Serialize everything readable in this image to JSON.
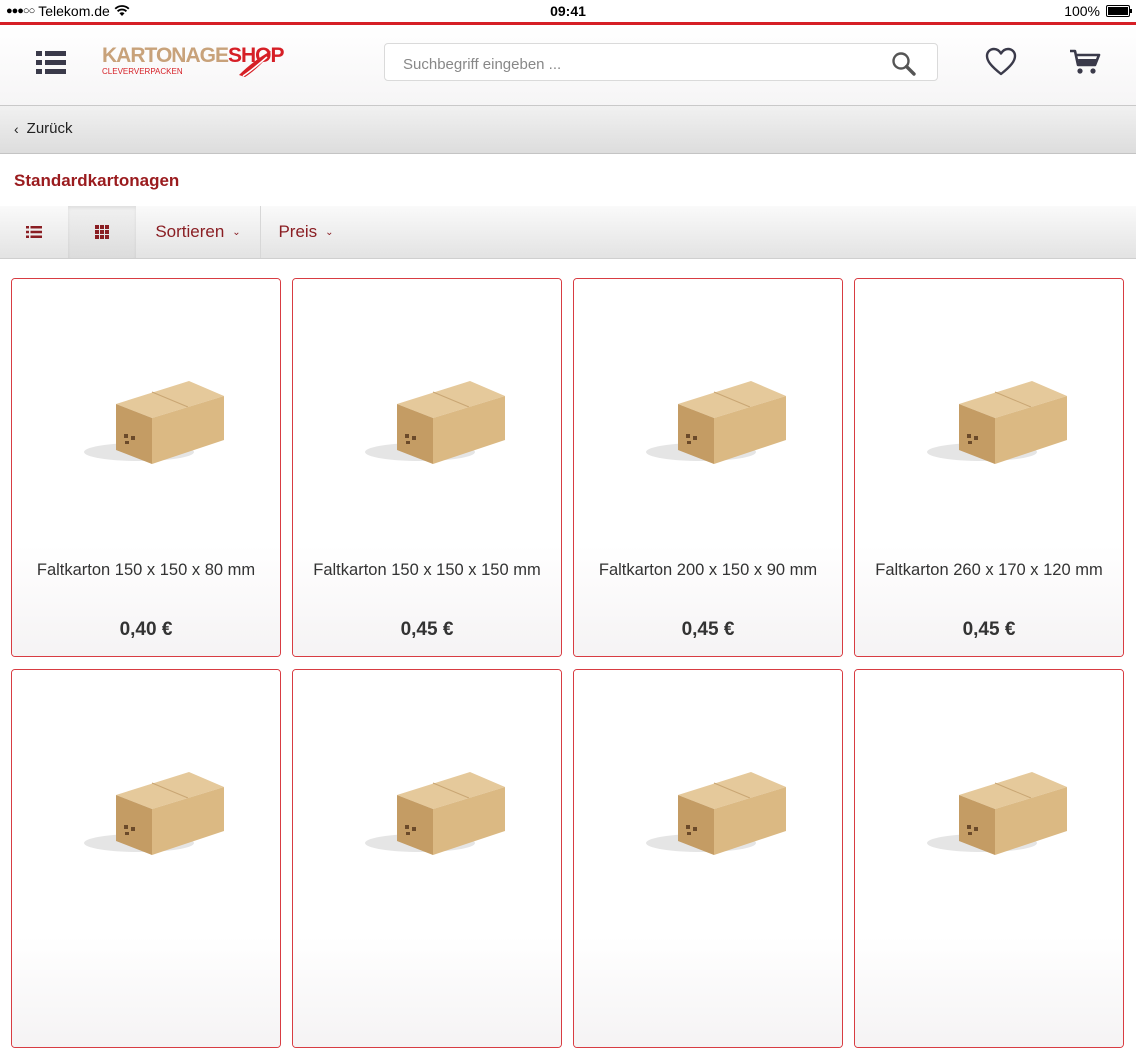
{
  "status_bar": {
    "carrier": "Telekom.de",
    "time": "09:41",
    "battery": "100%"
  },
  "header": {
    "logo": {
      "word1": "KARTONAGE",
      "word2": "SHOP",
      "tagline": "CLEVERVERPACKEN"
    },
    "search": {
      "placeholder": "Suchbegriff eingeben ..."
    }
  },
  "nav": {
    "back_label": "Zurück"
  },
  "category": {
    "title": "Standardkartonagen"
  },
  "toolbar": {
    "sort_label": "Sortieren",
    "price_label": "Preis",
    "active_view": "grid"
  },
  "colors": {
    "accent": "#d61f26",
    "title_red": "#9a1b1e",
    "card_border": "#d83c42"
  },
  "products": [
    {
      "name": "Faltkarton 150 x 150 x 80 mm",
      "price": "0,40 €"
    },
    {
      "name": "Faltkarton 150 x 150 x 150 mm",
      "price": "0,45 €"
    },
    {
      "name": "Faltkarton 200 x 150 x 90 mm",
      "price": "0,45 €"
    },
    {
      "name": "Faltkarton 260 x 170 x 120 mm",
      "price": "0,45 €"
    },
    {
      "name": "",
      "price": ""
    },
    {
      "name": "",
      "price": ""
    },
    {
      "name": "",
      "price": ""
    },
    {
      "name": "",
      "price": ""
    }
  ]
}
